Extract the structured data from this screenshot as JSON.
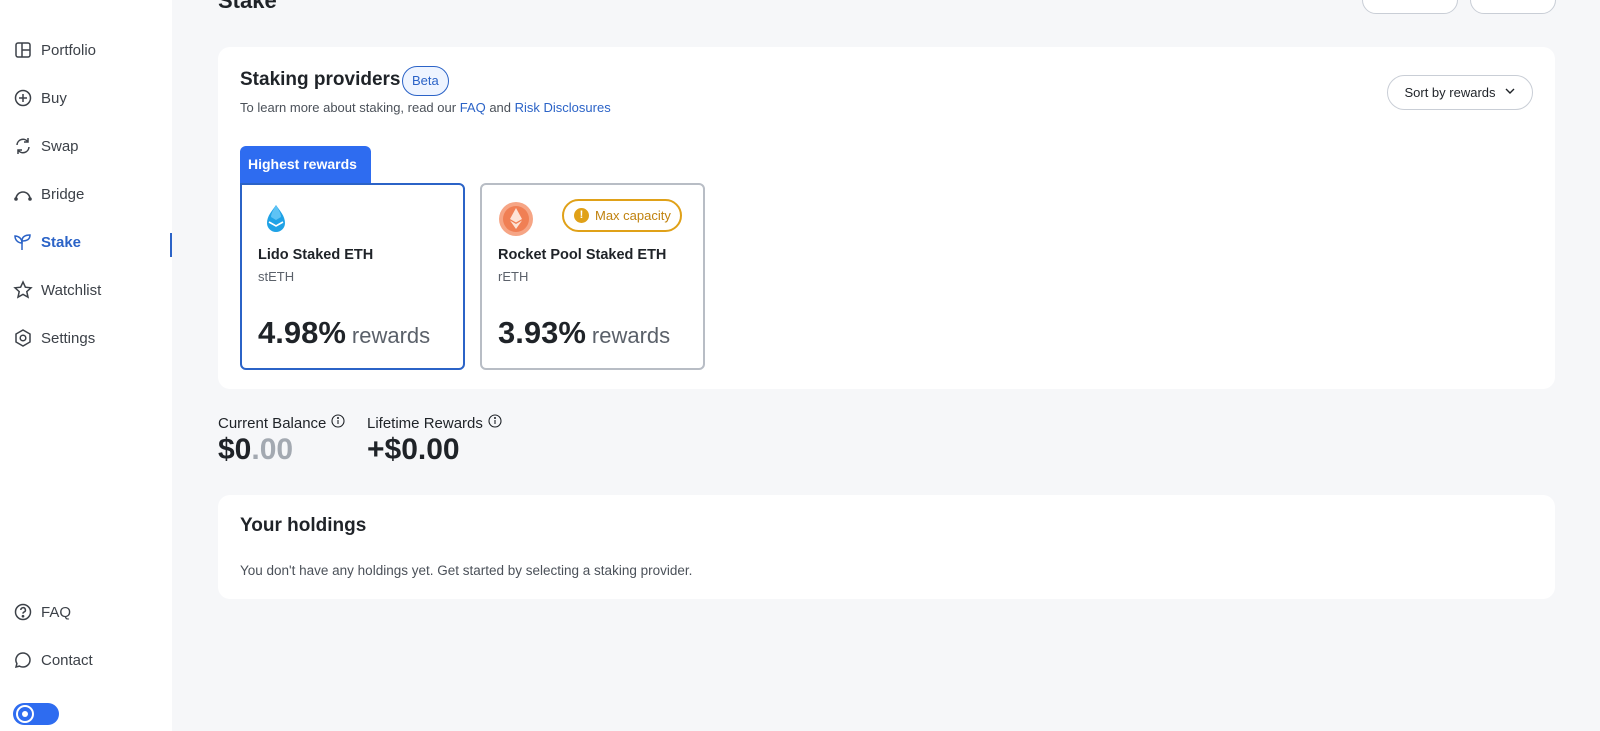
{
  "sidebar": {
    "items": [
      {
        "label": "Portfolio",
        "icon": "portfolio-icon"
      },
      {
        "label": "Buy",
        "icon": "plus-circle-icon"
      },
      {
        "label": "Swap",
        "icon": "swap-icon"
      },
      {
        "label": "Bridge",
        "icon": "bridge-icon"
      },
      {
        "label": "Stake",
        "icon": "sprout-icon",
        "active": true
      },
      {
        "label": "Watchlist",
        "icon": "star-icon"
      },
      {
        "label": "Settings",
        "icon": "gear-icon"
      }
    ],
    "bottom_items": [
      {
        "label": "FAQ",
        "icon": "question-circle-icon"
      },
      {
        "label": "Contact",
        "icon": "chat-icon"
      }
    ],
    "theme_toggle": "theme-toggle"
  },
  "header": {
    "title": "Stake"
  },
  "providers": {
    "title": "Staking providers",
    "badge": "Beta",
    "subtitle_prefix": "To learn more about staking, read our ",
    "faq_link": "FAQ",
    "and": " and ",
    "risk_link": "Risk Disclosures",
    "sort_label": "Sort by rewards",
    "highest_tag": "Highest rewards",
    "cards": [
      {
        "name": "Lido Staked ETH",
        "ticker": "stETH",
        "rate": "4.98%",
        "rate_label": "rewards"
      },
      {
        "name": "Rocket Pool Staked ETH",
        "ticker": "rETH",
        "rate": "3.93%",
        "rate_label": "rewards",
        "badge": "Max capacity"
      }
    ]
  },
  "balance": {
    "current_label": "Current Balance",
    "current_whole": "$0",
    "current_cents": ".00",
    "lifetime_label": "Lifetime Rewards",
    "lifetime_value": "+$0.00"
  },
  "holdings": {
    "title": "Your holdings",
    "empty_message": "You don't have any holdings yet. Get started by selecting a staking provider."
  },
  "colors": {
    "accent": "#2b63c7",
    "primary_button": "#2e6cf0",
    "warning": "#e0a118"
  }
}
